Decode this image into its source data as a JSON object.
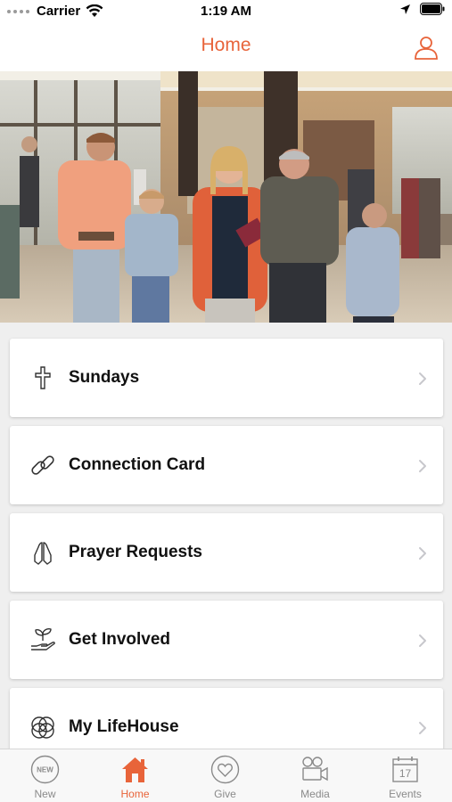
{
  "status_bar": {
    "carrier": "Carrier",
    "time": "1:19 AM"
  },
  "nav": {
    "title": "Home"
  },
  "accent_color": "#e8643a",
  "menu": {
    "items": [
      {
        "label": "Sundays",
        "icon": "cross-icon"
      },
      {
        "label": "Connection Card",
        "icon": "link-icon"
      },
      {
        "label": "Prayer Requests",
        "icon": "praying-hands-icon"
      },
      {
        "label": "Get Involved",
        "icon": "hand-plant-icon"
      },
      {
        "label": "My LifeHouse",
        "icon": "circles-icon"
      }
    ]
  },
  "tabs": [
    {
      "label": "New",
      "icon": "new-badge-icon",
      "active": false
    },
    {
      "label": "Home",
      "icon": "house-icon",
      "active": true
    },
    {
      "label": "Give",
      "icon": "heart-circle-icon",
      "active": false
    },
    {
      "label": "Media",
      "icon": "video-camera-icon",
      "active": false
    },
    {
      "label": "Events",
      "icon": "calendar-icon",
      "active": false
    }
  ],
  "new_badge_text": "NEW",
  "calendar_day": "17"
}
